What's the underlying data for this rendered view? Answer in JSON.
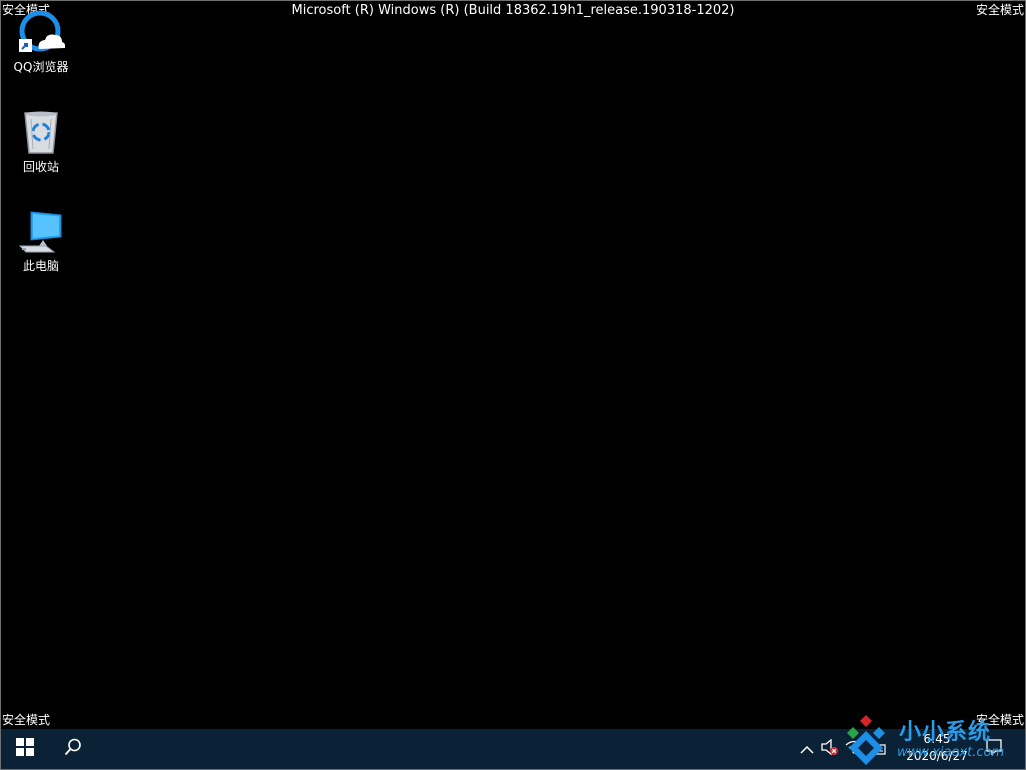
{
  "safe_mode": {
    "top_left": "安全模式",
    "top_right": "安全模式",
    "bottom_left": "安全模式",
    "bottom_right": "安全模式"
  },
  "build_info": "Microsoft (R) Windows (R) (Build 18362.19h1_release.190318-1202)",
  "desktop": {
    "icons": [
      {
        "label": "QQ浏览器",
        "icon": "qq-browser-icon"
      },
      {
        "label": "回收站",
        "icon": "recycle-bin-icon"
      },
      {
        "label": "此电脑",
        "icon": "this-pc-icon"
      }
    ]
  },
  "taskbar": {
    "start_icon": "windows-logo-icon",
    "search_icon": "search-icon",
    "tray": {
      "chevron_icon": "chevron-up-icon",
      "volume_icon": "volume-muted-icon",
      "network_icon": "network-icon",
      "notification_icon": "action-center-icon"
    },
    "clock": {
      "time": "6:45",
      "date": "2020/6/27"
    }
  },
  "watermark": {
    "title": "小小系统",
    "url": "www.xiaoxt.com"
  },
  "colors": {
    "taskbar": "#0b2236",
    "accent": "#2a9be6"
  }
}
